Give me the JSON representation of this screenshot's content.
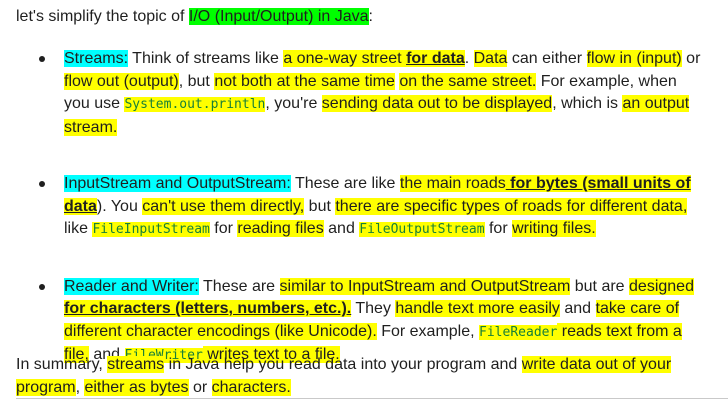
{
  "intro": {
    "lead": "let's simplify the topic of ",
    "topic": "I/O (Input/Output) in Java",
    "end": ":"
  },
  "bullets": {
    "streams": {
      "label": "Streams:",
      "t1": " Think of streams like ",
      "h1": "a one-way street ",
      "h1b": "for data",
      "t2": ". ",
      "h2": "Data",
      "t3": " can either ",
      "h3": "flow in (input)",
      "t4": " or ",
      "h4": "flow out (output)",
      "t5": ", but ",
      "h5": "not both at the same time",
      "t6": " ",
      "h6": "on the same street.",
      "t7": " For example, when you use ",
      "code1": "System.out.println",
      "t8": ", you're ",
      "h7": "sending data out to be displayed",
      "t9": ", which is ",
      "h8": "an output stream."
    },
    "inputstream": {
      "label": "InputStream and OutputStream:",
      "t1": " These are like ",
      "h1": "the main roads",
      "h1b": " for bytes (small units of data",
      "t2": "). You ",
      "h2": "can't use them directly,",
      "t3": " but ",
      "h3": "there are specific types of roads for different data,",
      "t4": " like ",
      "code1": "FileInputStream",
      "t5": " for ",
      "h4": "reading files",
      "t6": " and ",
      "code2": "FileOutputStream",
      "t7": " for ",
      "h5": "writing files."
    },
    "reader": {
      "label": "Reader and Writer:",
      "t1": " These are ",
      "h1": "similar to InputStream and OutputStream",
      "t2": " but are ",
      "h2": "designed",
      "h2b": "for characters (letters, numbers, etc.).",
      "t3": " They ",
      "h3": "handle text more easily",
      "t4": " and ",
      "h4": "take care of different character encodings (like Unicode).",
      "t5": " For example, ",
      "code1": "FileReader",
      "h5": " reads text from a file,",
      "t6": " and ",
      "code2": "FileWriter",
      "h6": " writes text to a file."
    }
  },
  "summary": {
    "t1": "In summary, ",
    "h1": "streams",
    "t2": " in Java help you read data into your program and ",
    "h2": "write data out of your program",
    "t3": ", ",
    "h3": "either as bytes",
    "t4": " or ",
    "h4": "characters."
  },
  "colors": {
    "highlight_yellow": "#ffff00",
    "highlight_green": "#00ff00",
    "highlight_cyan": "#00ffff",
    "code_green": "#188038"
  }
}
